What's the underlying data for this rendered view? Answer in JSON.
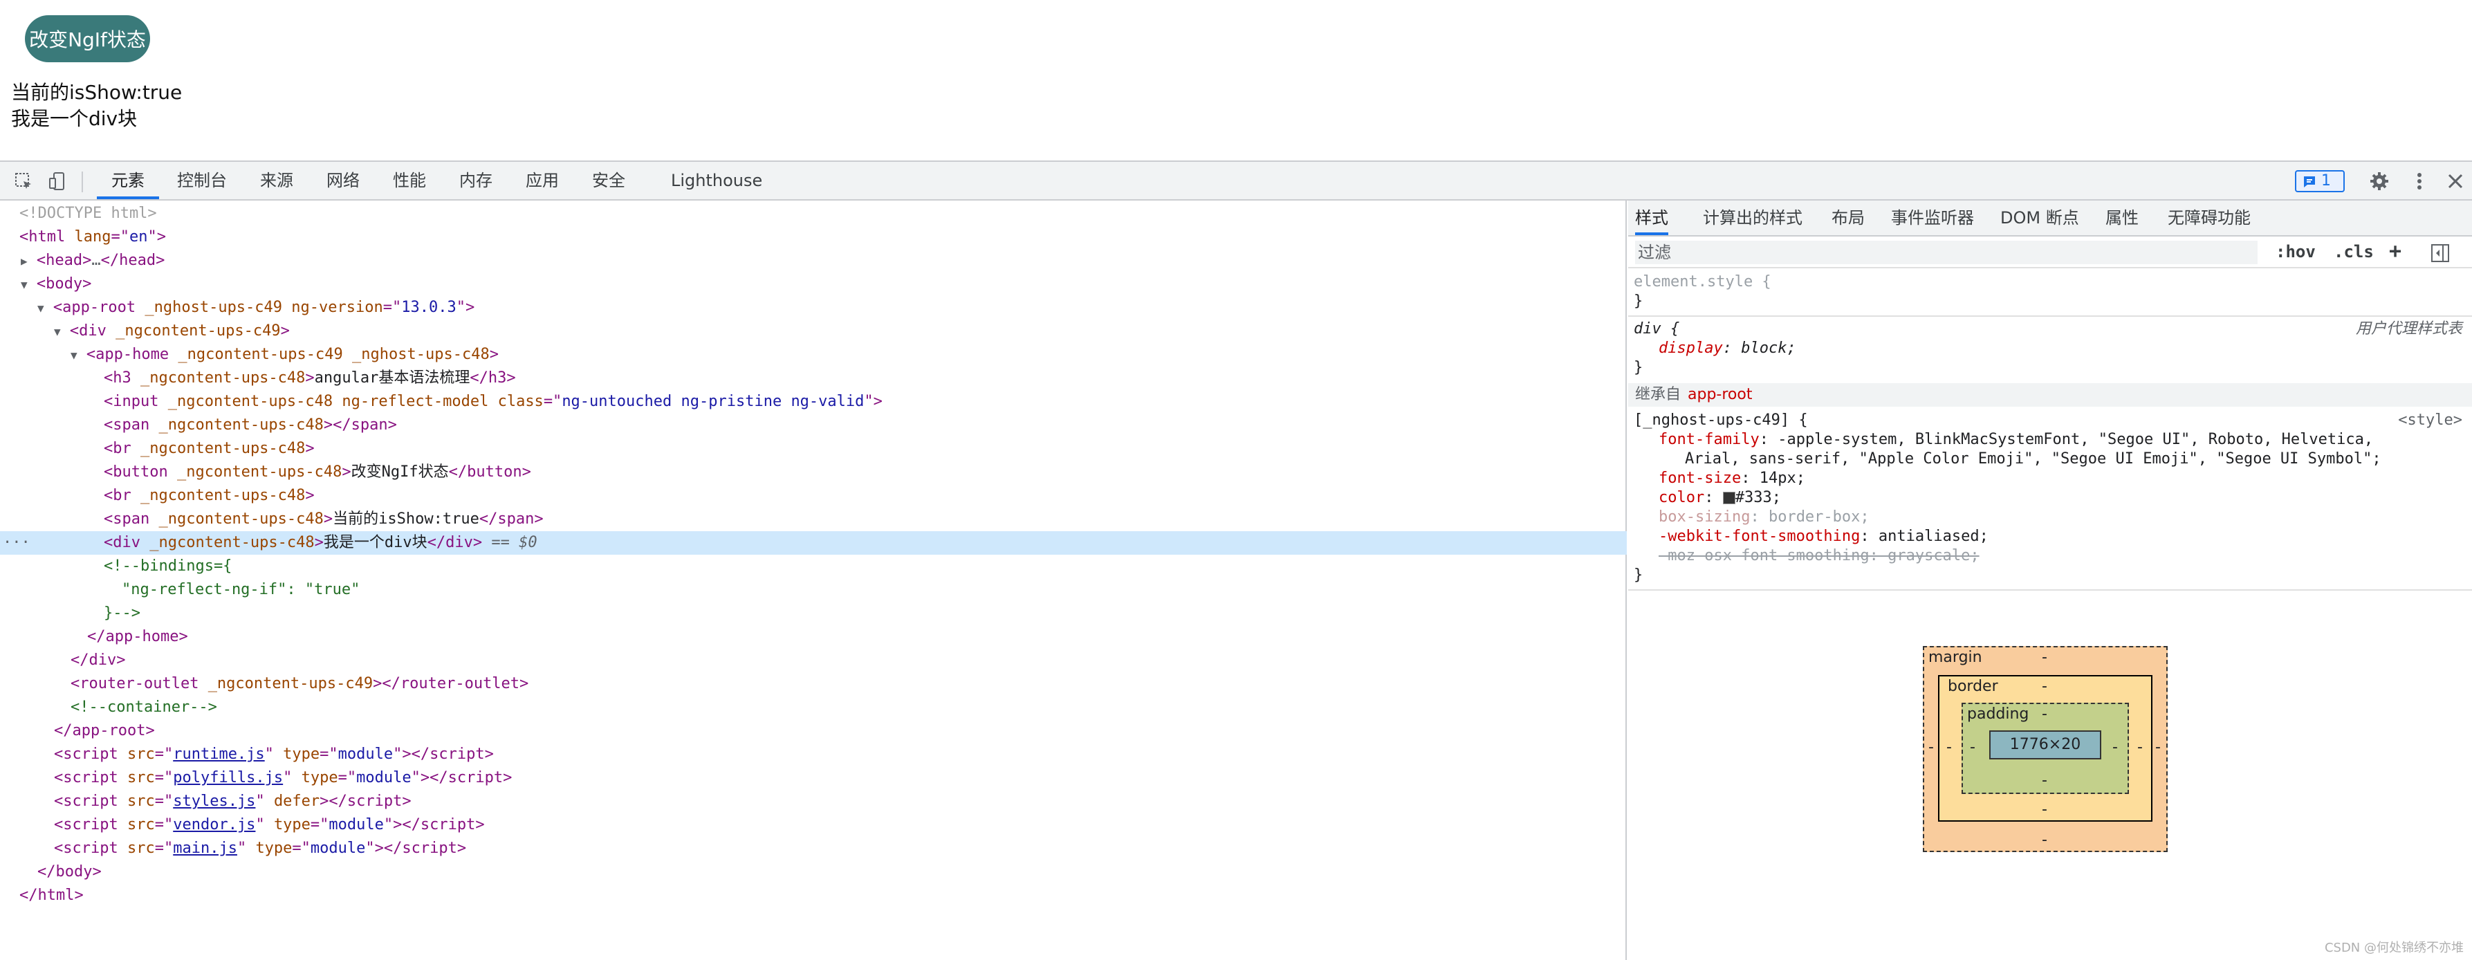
{
  "page": {
    "button_label": "改变NgIf状态",
    "status_text": "当前的isShow:true",
    "div_text": "我是一个div块"
  },
  "toolbar": {
    "tabs": [
      {
        "label": "元素",
        "active": true
      },
      {
        "label": "控制台"
      },
      {
        "label": "来源"
      },
      {
        "label": "网络"
      },
      {
        "label": "性能"
      },
      {
        "label": "内存"
      },
      {
        "label": "应用"
      },
      {
        "label": "安全"
      },
      {
        "label": "Lighthouse"
      }
    ],
    "issues_count": "1",
    "icons": [
      "inspect-element-icon",
      "device-toolbar-icon",
      "issues-icon",
      "gear-icon",
      "more-vert-icon",
      "close-icon"
    ]
  },
  "elements": {
    "doctype": "<!DOCTYPE html>",
    "html_tag": "html",
    "html_attr": "lang",
    "html_lang": "en",
    "head_open": "<head>",
    "head_close": "</head>",
    "ellipsis": "…",
    "body_tag": "body",
    "app_root_tag": "app-root",
    "app_root_attr1": "_nghost-ups-c49",
    "ng_version_attr": "ng-version",
    "ng_version": "13.0.3",
    "div_tag": "div",
    "ngcontent_c49": "_ngcontent-ups-c49",
    "app_home_tag": "app-home",
    "nghost_c48": "_nghost-ups-c48",
    "ngcontent_c48": "_ngcontent-ups-c48",
    "h3_text": "angular基本语法梳理",
    "input_attr2": "ng-reflect-model",
    "class_attr": "class",
    "class_value": "ng-untouched ng-pristine ng-valid",
    "button_text": "改变NgIf状态",
    "span_text": "当前的isShow:true",
    "div_text": "我是一个div块",
    "selected_suffix": "== $0",
    "comment_line1": "<!--bindings={",
    "comment_line2": "\"ng-reflect-ng-if\": \"true\"",
    "comment_line3": "}-->",
    "router_outlet_tag": "router-outlet",
    "container_comment": "<!--container-->",
    "scripts": [
      {
        "src": "runtime.js",
        "attr": "type",
        "value": "module"
      },
      {
        "src": "polyfills.js",
        "attr": "type",
        "value": "module"
      },
      {
        "src": "styles.js",
        "attr": "defer",
        "value": ""
      },
      {
        "src": "vendor.js",
        "attr": "type",
        "value": "module"
      },
      {
        "src": "main.js",
        "attr": "type",
        "value": "module"
      }
    ]
  },
  "sidebar": {
    "tabs": [
      {
        "label": "样式",
        "active": true
      },
      {
        "label": "计算出的样式"
      },
      {
        "label": "布局"
      },
      {
        "label": "事件监听器"
      },
      {
        "label": "DOM 断点"
      },
      {
        "label": "属性"
      },
      {
        "label": "无障碍功能"
      }
    ],
    "filter_placeholder": "过滤",
    "hov_label": ":hov",
    "cls_label": ".cls",
    "plus_label": "+",
    "element_style": "element.style {",
    "close_brace": "}",
    "ua_rule": {
      "selector": "div {",
      "source": "用户代理样式表",
      "prop": "display",
      "value": "block;"
    },
    "inherited_label": "继承自",
    "inherited_from": "app-root",
    "host_rule": {
      "selector": "[_nghost-ups-c49] {",
      "source": "<style>",
      "font_family_prop": "font-family",
      "font_family_value1": "-apple-system, BlinkMacSystemFont, \"Segoe UI\", Roboto, Helvetica,",
      "font_family_value2": "Arial, sans-serif, \"Apple Color Emoji\", \"Segoe UI Emoji\", \"Segoe UI Symbol\";",
      "font_size_prop": "font-size",
      "font_size_value": "14px;",
      "color_prop": "color",
      "color_value": "#333;",
      "box_sizing_prop": "box-sizing",
      "box_sizing_value": "border-box;",
      "webkit_prop": "-webkit-font-smoothing",
      "webkit_value": "antialiased;",
      "moz_line": "-moz-osx-font-smoothing: grayscale;"
    },
    "box_model": {
      "margin_label": "margin",
      "border_label": "border",
      "padding_label": "padding",
      "dash": "-",
      "content_size": "1776×20"
    },
    "watermark": "CSDN @何处锦绣不亦堆"
  },
  "colors": {
    "button_bg": "#3a7a7a",
    "accent": "#1a73e8",
    "selected_row": "#cfe8fc",
    "margin_box": "#f9cc9d",
    "border_box": "#fddd9b",
    "padding_box": "#c3d08b",
    "content_box": "#8cb6c0"
  }
}
